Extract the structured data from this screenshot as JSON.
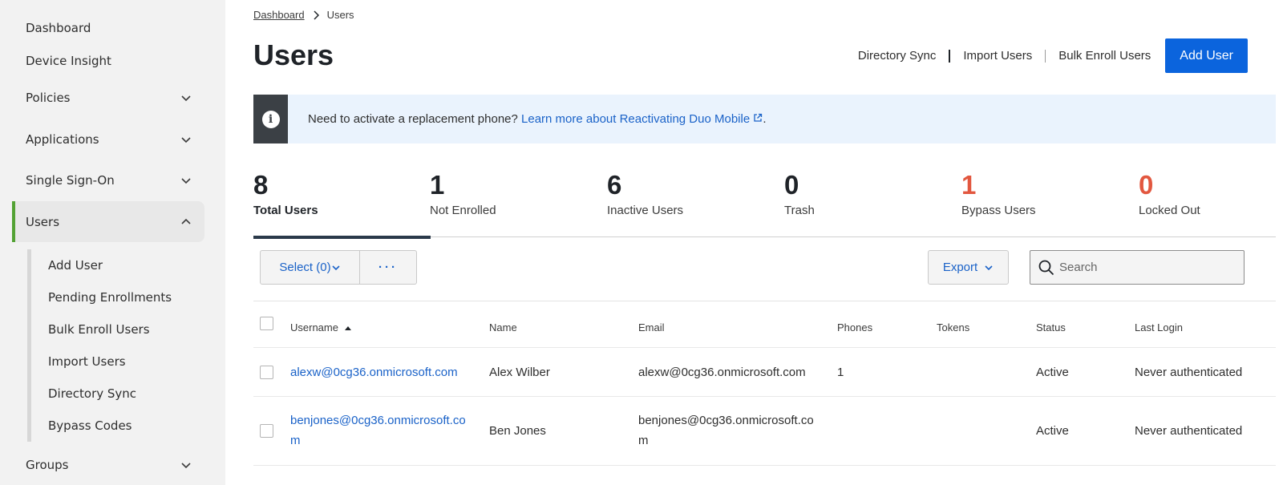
{
  "sidebar": {
    "items": [
      {
        "label": "Dashboard"
      },
      {
        "label": "Device Insight"
      },
      {
        "label": "Policies"
      },
      {
        "label": "Applications"
      },
      {
        "label": "Single Sign-On"
      },
      {
        "label": "Users"
      },
      {
        "label": "Groups"
      }
    ],
    "users_subitems": [
      {
        "label": "Add User"
      },
      {
        "label": "Pending Enrollments"
      },
      {
        "label": "Bulk Enroll Users"
      },
      {
        "label": "Import Users"
      },
      {
        "label": "Directory Sync"
      },
      {
        "label": "Bypass Codes"
      }
    ],
    "accent": "#53a234"
  },
  "breadcrumb": {
    "parent": "Dashboard",
    "current": "Users"
  },
  "page": {
    "title": "Users"
  },
  "actions": {
    "directory_sync": "Directory Sync",
    "import_users": "Import Users",
    "bulk_enroll": "Bulk Enroll Users",
    "add_user": "Add User"
  },
  "banner": {
    "text": "Need to activate a replacement phone?",
    "link": "Learn more about Reactivating Duo Mobile",
    "suffix": "."
  },
  "stats": [
    {
      "value": "8",
      "label": "Total Users"
    },
    {
      "value": "1",
      "label": "Not Enrolled"
    },
    {
      "value": "6",
      "label": "Inactive Users"
    },
    {
      "value": "0",
      "label": "Trash"
    },
    {
      "value": "1",
      "label": "Bypass Users"
    },
    {
      "value": "0",
      "label": "Locked Out"
    }
  ],
  "toolbar": {
    "select_label": "Select (0)",
    "more_label": "···",
    "export_label": "Export",
    "search_placeholder": "Search"
  },
  "table": {
    "headers": [
      "Username",
      "Name",
      "Email",
      "Phones",
      "Tokens",
      "Status",
      "Last Login"
    ],
    "rows": [
      {
        "username": "alexw@0cg36.onmicrosoft.com",
        "name": "Alex Wilber",
        "email": "alexw@0cg36.onmicrosoft.com",
        "phones": "1",
        "tokens": "",
        "status": "Active",
        "last_login": "Never authenticated"
      },
      {
        "username_line1": "benjones@0cg36.onmicrosoft.co",
        "username_line2": "m",
        "name": "Ben Jones",
        "email_line1": "benjones@0cg36.onmicrosoft.co",
        "email_line2": "m",
        "phones": "",
        "tokens": "",
        "status": "Active",
        "last_login": "Never authenticated"
      }
    ]
  },
  "colors": {
    "primary": "#0b64dd",
    "link": "#1a62c8",
    "danger": "#e2573f",
    "banner_bg": "#eaf3fd"
  }
}
